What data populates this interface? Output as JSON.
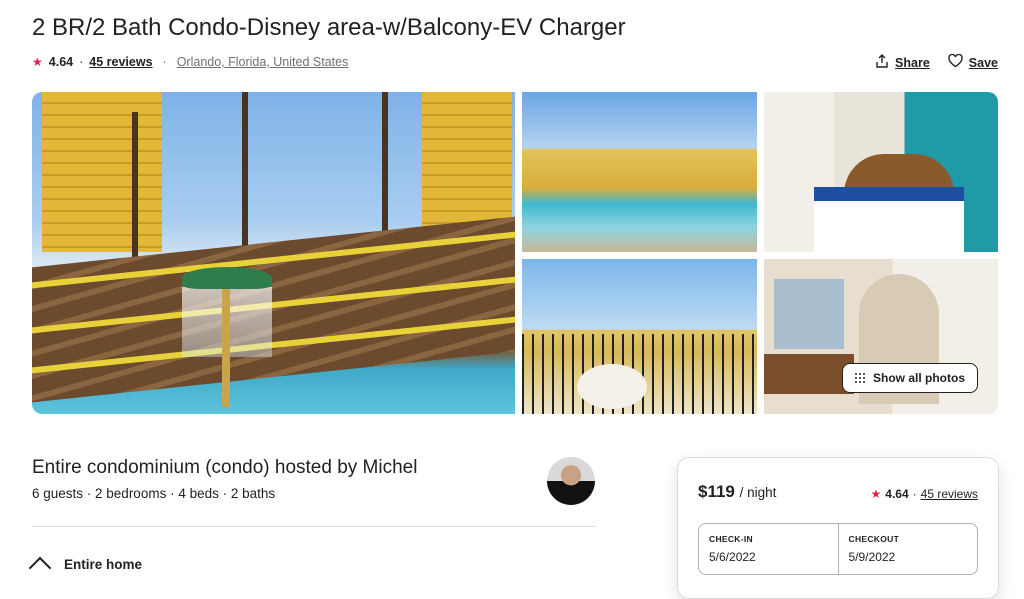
{
  "listing": {
    "title": "2 BR/2 Bath Condo-Disney area-w/Balcony-EV Charger",
    "rating": "4.64",
    "reviews_label": "45 reviews",
    "separator": "·",
    "location": "Orlando, Florida, United States"
  },
  "actions": {
    "share_label": "Share",
    "save_label": "Save"
  },
  "gallery": {
    "show_all_label": "Show all photos"
  },
  "host": {
    "title": "Entire condominium (condo) hosted by Michel",
    "details": "6 guests · 2 bedrooms · 4 beds · 2 baths",
    "next_feature": "Entire home"
  },
  "booking": {
    "price": "$119",
    "per": "/ night",
    "rating": "4.64",
    "reviews_label": "45 reviews",
    "checkin_label": "CHECK-IN",
    "checkin_value": "5/6/2022",
    "checkout_label": "CHECKOUT",
    "checkout_value": "5/9/2022"
  },
  "colors": {
    "accent": "#e61e4d",
    "text": "#222222",
    "muted": "#717171"
  }
}
